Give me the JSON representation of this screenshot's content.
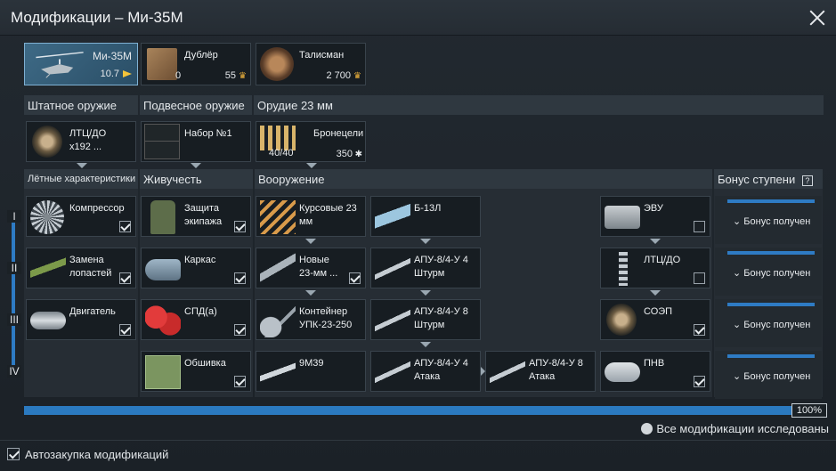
{
  "window": {
    "title": "Модификации – Ми-35М"
  },
  "top": {
    "vehicle": {
      "name": "Ми-35М",
      "rank": "10.7",
      "icon": "helicopter-icon"
    },
    "crew": {
      "label": "Дублёр",
      "count": "0",
      "price": "55",
      "icon": "backup-icon"
    },
    "talisman": {
      "label": "Талисман",
      "price": "2 700",
      "icon": "talisman-icon"
    }
  },
  "sections": {
    "weapon": "Штатное оружие",
    "suspended": "Подвесное оружие",
    "cannon": "Орудие 23 мм"
  },
  "weapons": {
    "gun": {
      "label": "ЛТЦ/ДО\nx192 ..."
    },
    "preset": {
      "label": "Набор №1"
    },
    "belt": {
      "label": "Бронецели",
      "ammo": "40/40",
      "price": "350"
    }
  },
  "tree_headers": {
    "flight": "Лётные характеристики",
    "survival": "Живучесть",
    "armament": "Вооружение",
    "bonus": "Бонус ступени",
    "bonus_help": "?"
  },
  "tiers": [
    "I",
    "II",
    "III",
    "IV"
  ],
  "flight": [
    {
      "label": "Компрессор",
      "icon": "compressor-icon"
    },
    {
      "label": "Замена\nлопастей",
      "icon": "rotor-blade-icon"
    },
    {
      "label": "Двигатель",
      "icon": "engine-icon"
    }
  ],
  "survival": [
    {
      "label": "Защита\nэкипажа",
      "icon": "crew-armor-icon"
    },
    {
      "label": "Каркас",
      "icon": "frame-icon"
    },
    {
      "label": "СПД(а)",
      "icon": "fire-extinguisher-icon"
    },
    {
      "label": "Обшивка",
      "icon": "skin-icon"
    }
  ],
  "arm1": [
    {
      "label": "Курсовые 23\nмм",
      "icon": "shells-icon"
    },
    {
      "label": "Новые\n23-мм ...",
      "icon": "cannon-icon"
    },
    {
      "label": "Контейнер\nУПК-23-250",
      "icon": "gunpod-icon"
    },
    {
      "label": "9М39",
      "icon": "missile-icon"
    }
  ],
  "arm2": [
    {
      "label": "Б-13Л",
      "icon": "rocket-pod-icon"
    },
    {
      "label": "АПУ-8/4-У 4\nШтурм",
      "icon": "launcher-icon"
    },
    {
      "label": "АПУ-8/4-У 8\nШтурм",
      "icon": "launcher-icon"
    },
    {
      "label": "АПУ-8/4-У 4\nАтака",
      "icon": "launcher-icon"
    }
  ],
  "arm3": {
    "label": "АПУ-8/4-У 8\nАтака",
    "icon": "launcher-icon"
  },
  "arm4": [
    {
      "label": "ЭВУ",
      "icon": "exhaust-icon"
    },
    {
      "label": "ЛТЦ/ДО",
      "icon": "flare-icon"
    },
    {
      "label": "СОЭП",
      "icon": "laser-warning-icon"
    },
    {
      "label": "ПНВ",
      "icon": "night-vision-icon"
    }
  ],
  "bonus_text": "Бонус получен",
  "progress": {
    "value": 1.0,
    "label": "100%"
  },
  "status": "Все модификации исследованы",
  "autobuy": "Автозакупка модификаций",
  "colors": {
    "accent": "#2e7bc4",
    "selected": "#3e6a86"
  }
}
